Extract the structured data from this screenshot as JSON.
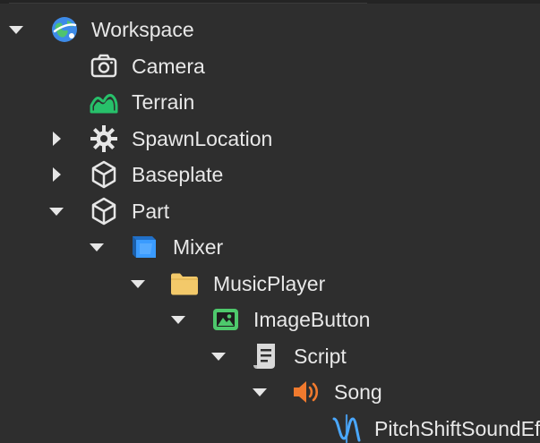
{
  "explorer": {
    "items": [
      {
        "label": "Workspace",
        "icon": "workspace-globe-icon",
        "toggle": "expanded"
      },
      {
        "label": "Camera",
        "icon": "camera-icon",
        "toggle": "none"
      },
      {
        "label": "Terrain",
        "icon": "terrain-icon",
        "toggle": "none"
      },
      {
        "label": "SpawnLocation",
        "icon": "spawn-location-gear-icon",
        "toggle": "collapsed"
      },
      {
        "label": "Baseplate",
        "icon": "part-cube-icon",
        "toggle": "collapsed"
      },
      {
        "label": "Part",
        "icon": "part-cube-icon",
        "toggle": "expanded"
      },
      {
        "label": "Mixer",
        "icon": "mixer-icon",
        "toggle": "expanded"
      },
      {
        "label": "MusicPlayer",
        "icon": "folder-icon",
        "toggle": "expanded"
      },
      {
        "label": "ImageButton",
        "icon": "image-button-icon",
        "toggle": "expanded"
      },
      {
        "label": "Script",
        "icon": "script-icon",
        "toggle": "expanded"
      },
      {
        "label": "Song",
        "icon": "sound-speaker-icon",
        "toggle": "expanded"
      },
      {
        "label": "PitchShiftSoundEffect",
        "icon": "pitch-shift-wave-icon",
        "toggle": "none"
      }
    ]
  },
  "colors": {
    "background": "#2e2e2e",
    "text": "#e8e8e8",
    "terrain": "#27c06a",
    "folder": "#f3c96a",
    "mixer": "#3a9bff",
    "image_button": "#4ec96c",
    "sound": "#f07a2e",
    "pitch_shift": "#4aa8ff",
    "globe": "#3d8be8"
  }
}
